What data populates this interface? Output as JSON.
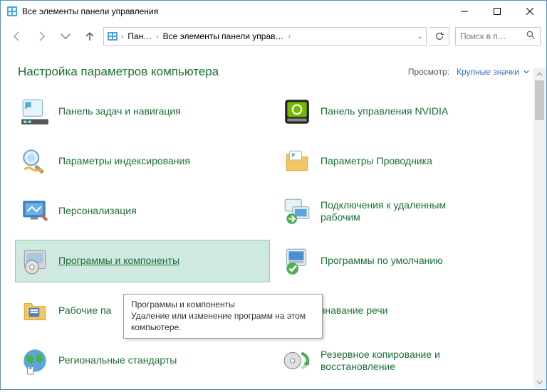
{
  "window": {
    "title": "Все элементы панели управления"
  },
  "breadcrumbs": {
    "item1": "Пан…",
    "item2": "Все элементы панели управ…"
  },
  "search": {
    "placeholder": "Поиск в п…"
  },
  "header": {
    "title": "Настройка параметров компьютера",
    "view_label": "Просмотр:",
    "view_value": "Крупные значки"
  },
  "items": [
    {
      "label": "Панель задач и навигация"
    },
    {
      "label": "Панель управления NVIDIA"
    },
    {
      "label": "Параметры индексирования"
    },
    {
      "label": "Параметры Проводника"
    },
    {
      "label": "Персонализация"
    },
    {
      "label": "Подключения к удаленным рабочим"
    },
    {
      "label": "Программы и компоненты"
    },
    {
      "label": "Программы по умолчанию"
    },
    {
      "label": "Рабочие па"
    },
    {
      "label": "знавание речи"
    },
    {
      "label": "Региональные стандарты"
    },
    {
      "label": "Резервное копирование и восстановление"
    }
  ],
  "tooltip": {
    "title": "Программы и компоненты",
    "body": "Удаление или изменение программ на этом компьютере."
  }
}
